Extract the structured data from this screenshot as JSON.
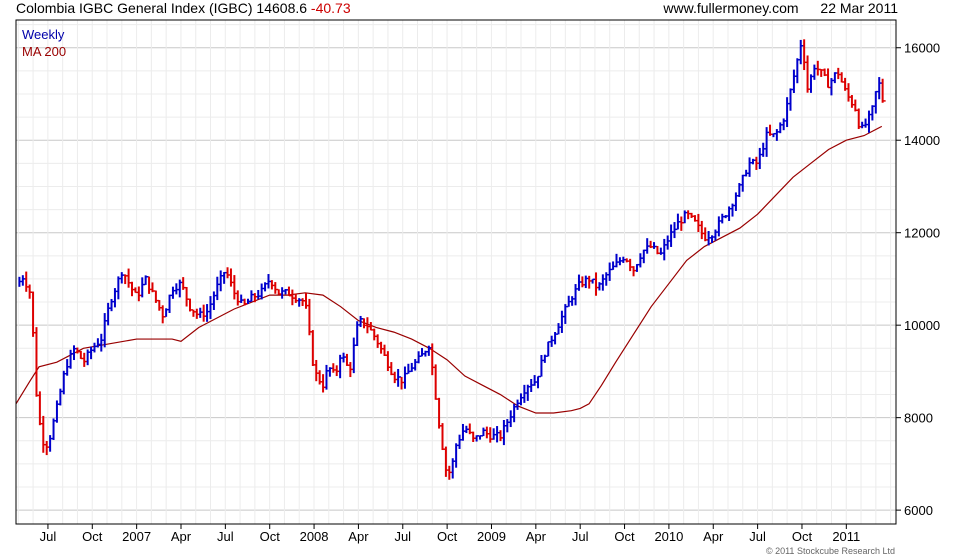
{
  "header": {
    "title": "Colombia IGBC General Index (IGBC)",
    "last_price": "14608.6",
    "change": "-40.73",
    "site": "www.fullermoney.com",
    "date": "22 Mar 2011"
  },
  "legend": {
    "series1": "Weekly",
    "series2": "MA 200"
  },
  "footer": {
    "copyright": "© 2011 Stockcube Research Ltd"
  },
  "colors": {
    "up": "#0000cc",
    "down": "#dd0000",
    "ma": "#990000",
    "grid": "#d8d8d8",
    "axis": "#000000"
  },
  "chart_data": {
    "type": "line",
    "ylim": [
      5700,
      16600
    ],
    "y_ticks": [
      6000,
      8000,
      10000,
      12000,
      14000,
      16000
    ],
    "x_range": [
      2006.32,
      2011.28
    ],
    "x_tick_labels": [
      {
        "x": 2006.5,
        "label": "Jul"
      },
      {
        "x": 2006.75,
        "label": "Oct"
      },
      {
        "x": 2007.0,
        "label": "2007"
      },
      {
        "x": 2007.25,
        "label": "Apr"
      },
      {
        "x": 2007.5,
        "label": "Jul"
      },
      {
        "x": 2007.75,
        "label": "Oct"
      },
      {
        "x": 2008.0,
        "label": "2008"
      },
      {
        "x": 2008.25,
        "label": "Apr"
      },
      {
        "x": 2008.5,
        "label": "Jul"
      },
      {
        "x": 2008.75,
        "label": "Oct"
      },
      {
        "x": 2009.0,
        "label": "2009"
      },
      {
        "x": 2009.25,
        "label": "Apr"
      },
      {
        "x": 2009.5,
        "label": "Jul"
      },
      {
        "x": 2009.75,
        "label": "Oct"
      },
      {
        "x": 2010.0,
        "label": "2010"
      },
      {
        "x": 2010.25,
        "label": "Apr"
      },
      {
        "x": 2010.5,
        "label": "Jul"
      },
      {
        "x": 2010.75,
        "label": "Oct"
      },
      {
        "x": 2011.0,
        "label": "2011"
      }
    ],
    "series": [
      {
        "name": "Weekly",
        "x": [
          2006.32,
          2006.36,
          2006.4,
          2006.42,
          2006.44,
          2006.47,
          2006.5,
          2006.55,
          2006.6,
          2006.65,
          2006.7,
          2006.75,
          2006.8,
          2006.85,
          2006.92,
          2006.97,
          2007.0,
          2007.05,
          2007.1,
          2007.15,
          2007.2,
          2007.25,
          2007.3,
          2007.35,
          2007.4,
          2007.45,
          2007.5,
          2007.55,
          2007.6,
          2007.65,
          2007.7,
          2007.75,
          2007.8,
          2007.85,
          2007.9,
          2007.95,
          2008.0,
          2008.05,
          2008.08,
          2008.12,
          2008.15,
          2008.2,
          2008.25,
          2008.3,
          2008.35,
          2008.4,
          2008.45,
          2008.5,
          2008.55,
          2008.6,
          2008.65,
          2008.7,
          2008.75,
          2008.78,
          2008.8,
          2008.85,
          2008.9,
          2008.95,
          2009.0,
          2009.05,
          2009.1,
          2009.15,
          2009.2,
          2009.25,
          2009.3,
          2009.35,
          2009.4,
          2009.45,
          2009.5,
          2009.55,
          2009.6,
          2009.65,
          2009.7,
          2009.75,
          2009.8,
          2009.85,
          2009.9,
          2009.95,
          2010.0,
          2010.05,
          2010.1,
          2010.15,
          2010.2,
          2010.25,
          2010.3,
          2010.35,
          2010.4,
          2010.45,
          2010.5,
          2010.55,
          2010.6,
          2010.65,
          2010.7,
          2010.75,
          2010.78,
          2010.82,
          2010.85,
          2010.9,
          2010.95,
          2011.0,
          2011.05,
          2011.08,
          2011.12,
          2011.15,
          2011.18,
          2011.22
        ],
        "values": [
          10850,
          11050,
          10700,
          9600,
          8200,
          7500,
          7400,
          8200,
          9100,
          9500,
          9200,
          9500,
          9700,
          10500,
          11200,
          10800,
          10600,
          11000,
          10600,
          10200,
          10800,
          10900,
          10400,
          10200,
          10300,
          10800,
          11200,
          10700,
          10400,
          10600,
          10700,
          11000,
          10700,
          10700,
          10600,
          10500,
          9000,
          8700,
          9100,
          8900,
          9400,
          9000,
          10100,
          10000,
          9700,
          9300,
          8900,
          8800,
          9100,
          9300,
          9600,
          8000,
          6700,
          7000,
          7400,
          7800,
          7500,
          7700,
          7600,
          7600,
          8000,
          8400,
          8700,
          8800,
          9400,
          9800,
          10200,
          10600,
          10900,
          11000,
          10800,
          11100,
          11300,
          11500,
          11200,
          11600,
          11700,
          11500,
          11900,
          12200,
          12400,
          12200,
          11900,
          12000,
          12300,
          12600,
          13000,
          13500,
          13500,
          14100,
          14100,
          14500,
          15300,
          16200,
          15100,
          15600,
          15500,
          15200,
          15500,
          15000,
          14700,
          14200,
          14400,
          14700,
          15300,
          14608
        ]
      },
      {
        "name": "MA 200",
        "x": [
          2006.32,
          2006.4,
          2006.45,
          2006.55,
          2006.7,
          2006.85,
          2007.0,
          2007.1,
          2007.2,
          2007.25,
          2007.35,
          2007.45,
          2007.55,
          2007.65,
          2007.75,
          2007.85,
          2007.95,
          2008.05,
          2008.15,
          2008.25,
          2008.35,
          2008.45,
          2008.55,
          2008.65,
          2008.75,
          2008.85,
          2008.95,
          2009.05,
          2009.15,
          2009.25,
          2009.35,
          2009.45,
          2009.5,
          2009.55,
          2009.62,
          2009.7,
          2009.8,
          2009.9,
          2010.0,
          2010.1,
          2010.2,
          2010.3,
          2010.4,
          2010.5,
          2010.6,
          2010.7,
          2010.8,
          2010.9,
          2011.0,
          2011.1,
          2011.2
        ],
        "values": [
          8300,
          8800,
          9100,
          9200,
          9500,
          9600,
          9700,
          9700,
          9700,
          9650,
          9950,
          10150,
          10350,
          10500,
          10650,
          10650,
          10700,
          10650,
          10400,
          10100,
          9950,
          9850,
          9700,
          9500,
          9250,
          8900,
          8700,
          8500,
          8250,
          8100,
          8100,
          8150,
          8200,
          8300,
          8700,
          9200,
          9800,
          10400,
          10900,
          11400,
          11700,
          11900,
          12100,
          12400,
          12800,
          13200,
          13500,
          13800,
          14000,
          14100,
          14300
        ]
      }
    ]
  }
}
